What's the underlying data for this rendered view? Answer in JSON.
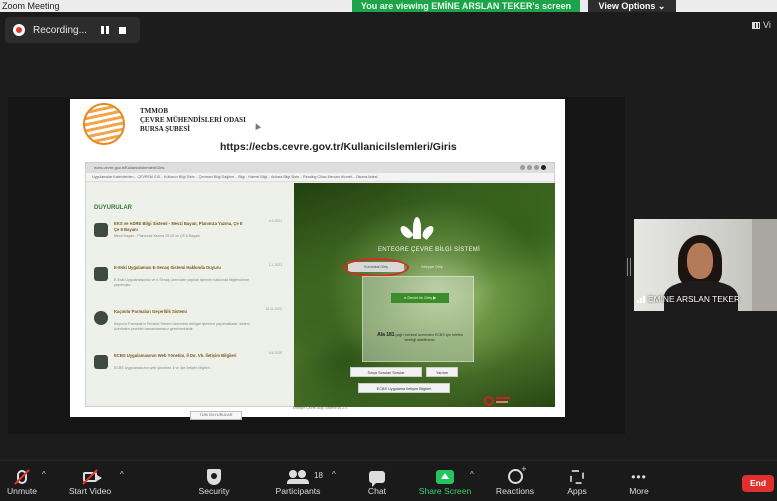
{
  "window": {
    "title": "Zoom Meeting"
  },
  "banner": {
    "viewing_text": "You are viewing EMİNE ARSLAN TEKER's screen",
    "view_options": "View Options ⌄"
  },
  "recording": {
    "label": "Recording..."
  },
  "view_button": {
    "label": "Vi"
  },
  "slide": {
    "org_line1": "TMMOB",
    "org_line2": "ÇEVRE MÜHENDİSLERİ ODASI",
    "org_line3": "BURSA ŞUBESİ",
    "url": "https://ecbs.cevre.gov.tr/Kullanicilslemleri/Giris",
    "browser": {
      "address": "ecbs.cevre.gov.tr/KullaniciIslemleri/Giris",
      "bookmarks": "Uygulamalar   Kalenderden...   ÇEVREM GİS...   Kullanıcı Bilgi Siste...   Çevresel Bilgi Dağıtım...   Bilgi - Hizmet Bilgi...   Ankara Bilgi Siste...   Reading Cihaz   Mercan Hizmet...   Okuma listesi",
      "news_heading": "DUYURULAR",
      "news": [
        {
          "headline": "EKS ve ADRE Bilgi Sistemi - Mevzi Bayan, Planınıza Yazma, Çe E Çe 8 Bayanı",
          "text": "Mevzi bayan - Planınıza Yazma 28.02 ve ÇE 6 Bayanı",
          "date": "4.6.2021"
        },
        {
          "headline": "E-Eski Uygulaması E-Senaş Sistemi Hakkında Duyuru",
          "text": "E-Eski Uygulamasında ve e-Senaş üzerinden yapılan işlemler hakkında bilgilendirme yapılmıştır.",
          "date": "1.1.2021"
        },
        {
          "headline": "Kaçınılır Parmaları Geçerlilik Sistemi",
          "text": "Kaçınılır Parmaların Temsilci Sistem üzerinden tebligat işlemleri yapılmaktadır, sistem üzerinden çevreleri tamamlamanız gerekmektedir.",
          "date": "18.11.2020"
        },
        {
          "headline": "ECBS Uygulamasının Web Yönetim, İl Dır. Vb. İletişim Bilgileri",
          "text": "ECBS Uygulamasının web yönetimi, il ve ilçe iletişim bilgileri.",
          "date": "4.6.2020"
        }
      ],
      "all_news": "TÜM DUYURULAR",
      "system_title": "ENTEGRE ÇEVRE BİLGİ SİSTEMİ",
      "tab_kurum": "Kurumsal Giriş",
      "tab_bireysel": "Bireysel Giriş",
      "login_button": "e-Devlet ile Giriş ▶",
      "login_info_count": "Ala 181",
      "login_info_text": "çağrı merkezi üzerinden ECBS için telefon desteği alabilirsiniz.",
      "btn_help": "Sıkça Sorulan Sorular",
      "btn_note": "Yardım",
      "btn_doc": "ECBS Uygulama İletişim Bilgileri",
      "footer": "Entegre Çevre Bilgi Sistemi v4.2.0"
    }
  },
  "participant": {
    "name": "EMİNE ARSLAN TEKER"
  },
  "toolbar": {
    "unmute": "Unmute",
    "start_video": "Start Video",
    "security": "Security",
    "participants": "Participants",
    "participants_count": "18",
    "chat": "Chat",
    "share_screen": "Share Screen",
    "reactions": "Reactions",
    "apps": "Apps",
    "more": "More",
    "end": "End",
    "caret": "^",
    "dots": "•••"
  },
  "colors": {
    "share_green": "#22c55e",
    "banner_green": "#1fa34a",
    "end_red": "#e02f2f",
    "highlight_red": "#d32e23"
  }
}
